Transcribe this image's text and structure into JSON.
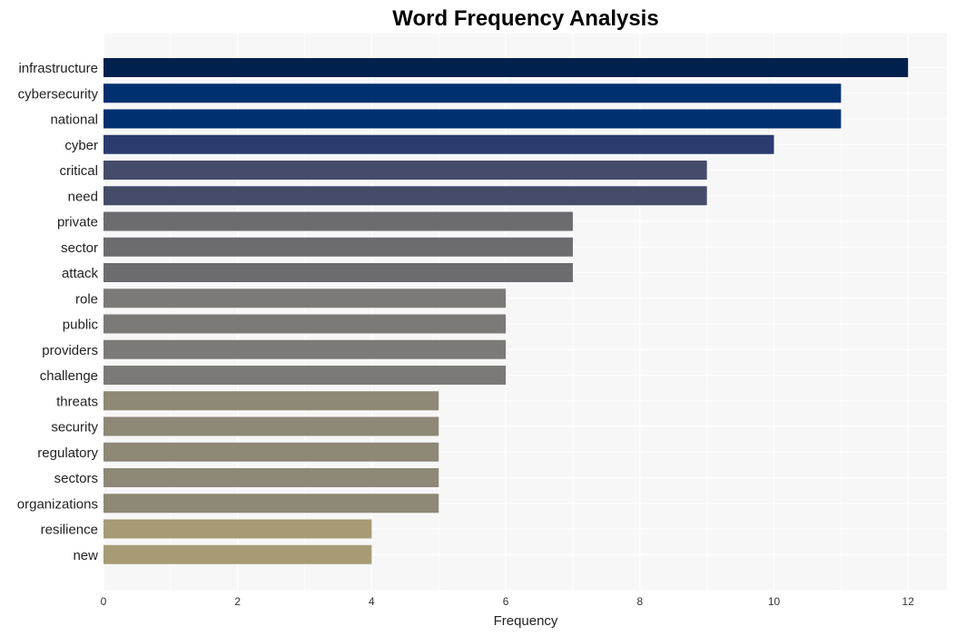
{
  "chart_data": {
    "type": "bar",
    "orientation": "horizontal",
    "title": "Word Frequency Analysis",
    "xlabel": "Frequency",
    "ylabel": "",
    "xlim": [
      0,
      12.6
    ],
    "xticks": [
      0,
      2,
      4,
      6,
      8,
      10,
      12
    ],
    "grid": true,
    "legend": "none",
    "categories": [
      "infrastructure",
      "cybersecurity",
      "national",
      "cyber",
      "critical",
      "need",
      "private",
      "sector",
      "attack",
      "role",
      "public",
      "providers",
      "challenge",
      "threats",
      "security",
      "regulatory",
      "sectors",
      "organizations",
      "resilience",
      "new"
    ],
    "values": [
      12,
      11,
      11,
      10,
      9,
      9,
      7,
      7,
      7,
      6,
      6,
      6,
      6,
      5,
      5,
      5,
      5,
      5,
      4,
      4
    ],
    "colors": [
      "#00214d",
      "#00306f",
      "#00306f",
      "#293c6d",
      "#444c6a",
      "#444c6a",
      "#6b6b70",
      "#6b6b70",
      "#6b6b70",
      "#7c7a77",
      "#7c7a77",
      "#7c7a77",
      "#7c7a77",
      "#8e8876",
      "#8e8876",
      "#8e8876",
      "#8e8876",
      "#8e8876",
      "#a69b74",
      "#a69b74"
    ],
    "panel_background": "#f7f7f7",
    "grid_color": "#ffffff"
  }
}
